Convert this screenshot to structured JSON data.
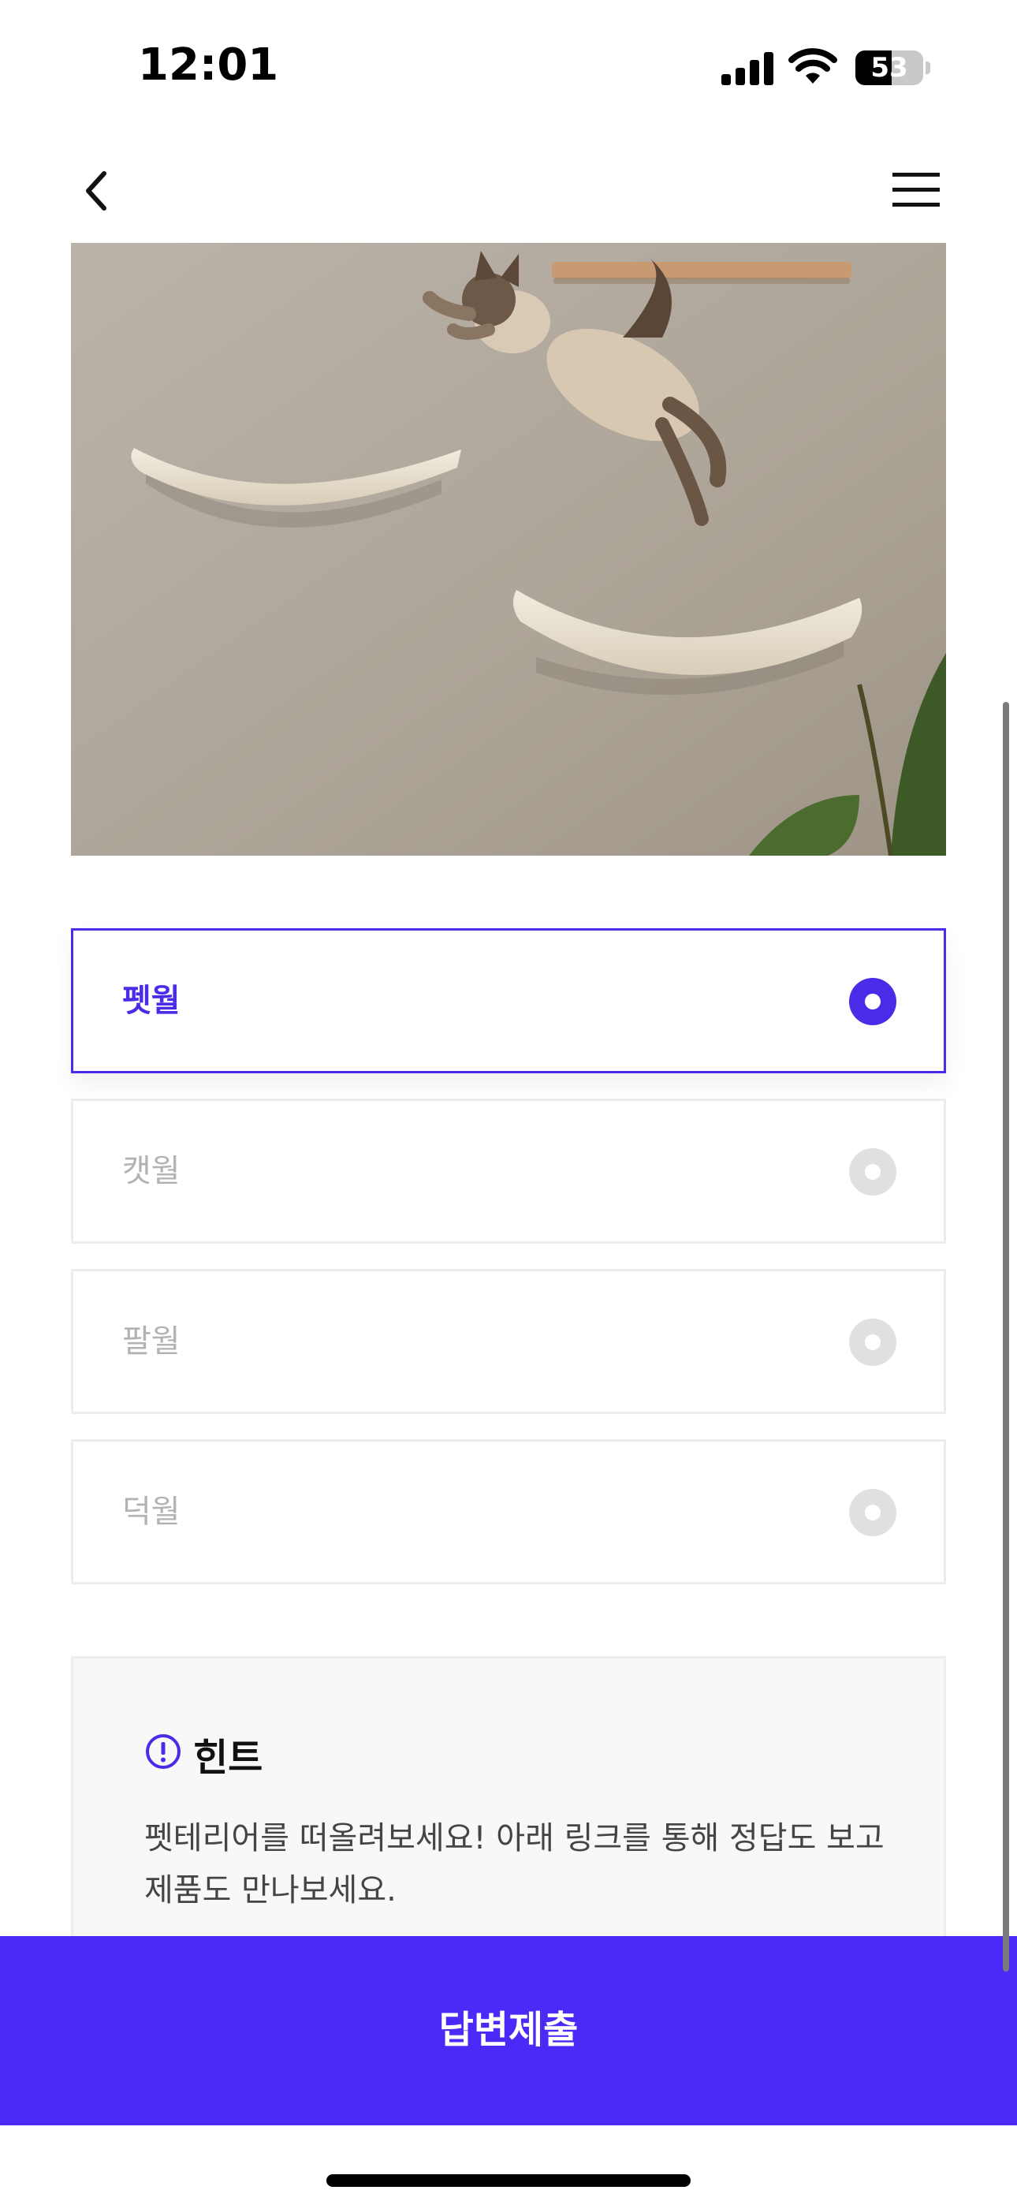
{
  "status_bar": {
    "time": "12:01",
    "battery_percent": "53",
    "battery_level": 0.53
  },
  "nav": {
    "back_icon": "chevron-left-icon",
    "menu_icon": "hamburger-menu-icon"
  },
  "quiz": {
    "options": [
      {
        "label": "펫월",
        "selected": true
      },
      {
        "label": "캣월",
        "selected": false
      },
      {
        "label": "팔월",
        "selected": false
      },
      {
        "label": "덕월",
        "selected": false
      }
    ],
    "hint": {
      "icon": "exclamation-circle-icon",
      "title": "힌트",
      "body": "펫테리어를 떠올려보세요! 아래 링크를 통해 정답도 보고 제품도 만나보세요."
    },
    "submit_label": "답변제출"
  },
  "colors": {
    "accent": "#4a2be8",
    "submit_bg": "#4a2af6",
    "option_border": "#ececec",
    "hint_bg": "#f8f8f8"
  }
}
